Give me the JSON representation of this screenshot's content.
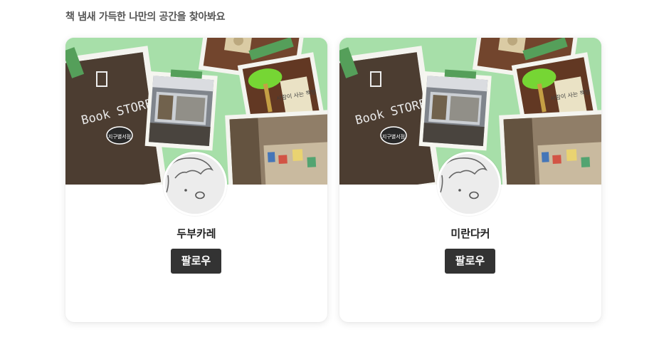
{
  "section": {
    "title": "책 냄새 가득한 나만의 공간을 찾아봐요"
  },
  "cards": [
    {
      "nickname": "두부카레",
      "follow_label": "팔로우",
      "cover_text": "Book STORE",
      "cover_badge": "지구별서점",
      "cover_book_title": "사람이 사는 책방"
    },
    {
      "nickname": "미란다커",
      "follow_label": "팔로우",
      "cover_text": "Book STORE",
      "cover_badge": "지구별서점",
      "cover_book_title": "사람이 사는 책방"
    }
  ],
  "colors": {
    "cover_background": "#9fdfa4",
    "button_background": "#333333",
    "avatar_background": "#ececec"
  }
}
